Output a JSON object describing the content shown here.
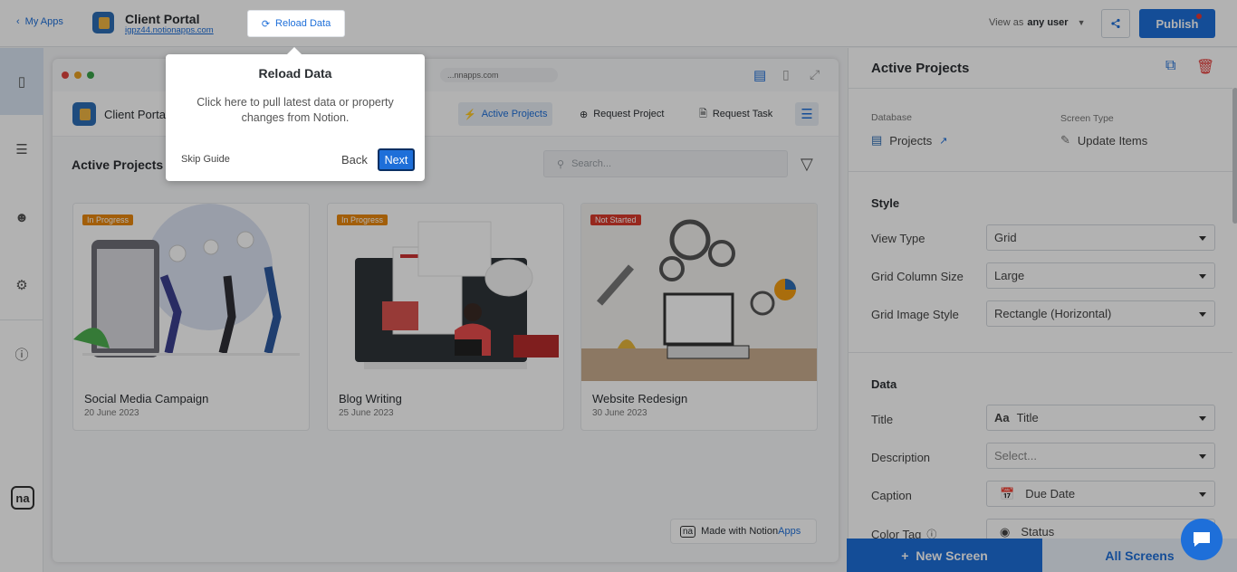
{
  "topbar": {
    "back_label": "My Apps",
    "app_title": "Client Portal",
    "app_url": "igpz44.notionapps.com",
    "reload_label": "Reload Data",
    "view_as_prefix": "View as",
    "view_as_value": "any user",
    "publish_label": "Publish"
  },
  "preview": {
    "url": "...nnapps.com",
    "app_title": "Client Portal",
    "nav": [
      "Active Projects",
      "Request Project",
      "Request Task"
    ],
    "section_title": "Active Projects",
    "search_placeholder": "Search...",
    "cards": [
      {
        "title": "Social Media Campaign",
        "date": "20 June 2023",
        "status": "In Progress",
        "status_color": "#e8870e"
      },
      {
        "title": "Blog Writing",
        "date": "25 June 2023",
        "status": "In Progress",
        "status_color": "#e8870e"
      },
      {
        "title": "Website Redesign",
        "date": "30 June 2023",
        "status": "Not Started",
        "status_color": "#d93a2b"
      }
    ],
    "made_with_prefix": "Made with Notion",
    "made_with_suffix": "Apps"
  },
  "tooltip": {
    "title": "Reload Data",
    "body": "Click here to pull latest data or property changes from Notion.",
    "skip": "Skip Guide",
    "back": "Back",
    "next": "Next"
  },
  "panel": {
    "title": "Active Projects",
    "database_label": "Database",
    "database_value": "Projects",
    "screen_type_label": "Screen Type",
    "screen_type_value": "Update Items",
    "style_heading": "Style",
    "style_rows": [
      {
        "label": "View Type",
        "value": "Grid"
      },
      {
        "label": "Grid Column Size",
        "value": "Large"
      },
      {
        "label": "Grid Image Style",
        "value": "Rectangle (Horizontal)"
      }
    ],
    "data_heading": "Data",
    "data_rows": [
      {
        "label": "Title",
        "value": "Title",
        "prefix": "Aa"
      },
      {
        "label": "Description",
        "value": "Select...",
        "prefix": ""
      },
      {
        "label": "Caption",
        "value": "Due Date",
        "prefix": "cal"
      },
      {
        "label": "Color Tag",
        "value": "Status",
        "prefix": "circ"
      }
    ],
    "new_screen_label": "New Screen",
    "all_screens_label": "All Screens"
  },
  "colors": {
    "accent": "#1e6fd9",
    "danger": "#e53935"
  }
}
